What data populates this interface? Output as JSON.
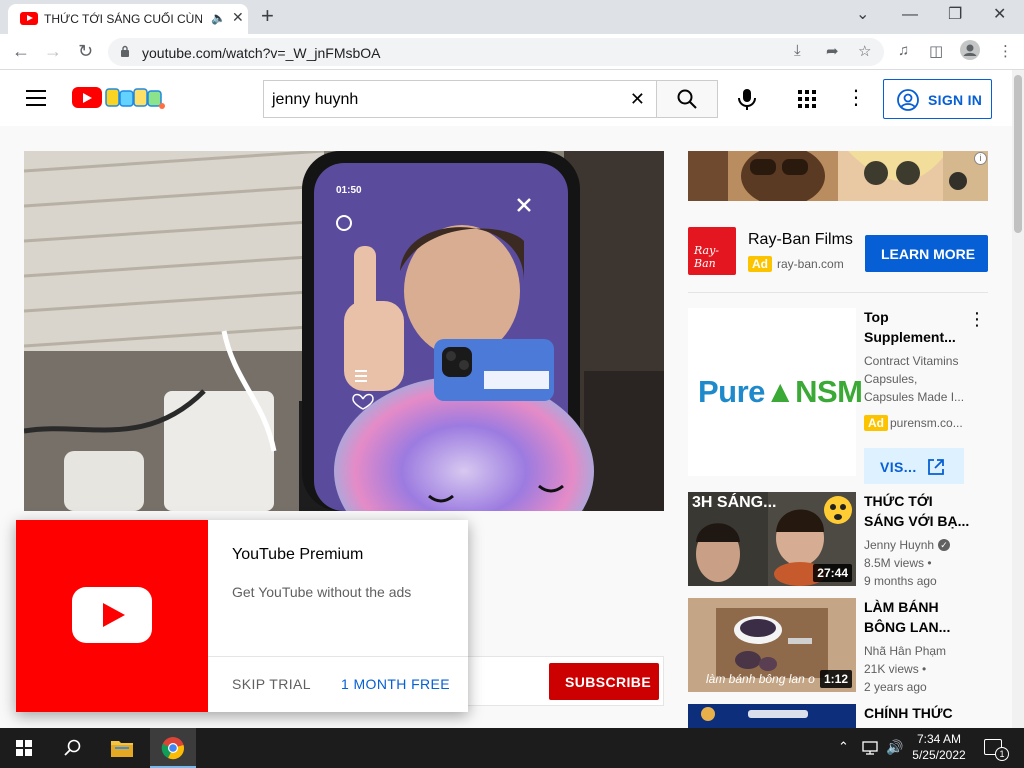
{
  "browser": {
    "tab_title": "THỨC TỚI SÁNG CUỐI CÙNG",
    "url": "youtube.com/watch?v=_W_jnFMsbOA"
  },
  "youtube": {
    "search_value": "jenny huynh",
    "sign_in_label": "SIGN IN"
  },
  "premium_popup": {
    "title": "YouTube Premium",
    "subtitle": "Get YouTube without the ads",
    "skip_label": "SKIP TRIAL",
    "free_label": "1 MONTH FREE"
  },
  "player": {
    "phone_time": "01:50",
    "subscribe_label": "SUBSCRIBE"
  },
  "ad_rayban": {
    "name": "Ray-Ban Films",
    "badge": "Ad",
    "domain": "ray-ban.com",
    "cta": "LEARN MORE",
    "logo_text": "Ray-Ban"
  },
  "ad_pure": {
    "title_line1": "Top",
    "title_line2": "Supplement...",
    "desc_line1": "Contract Vitamins",
    "desc_line2": "Capsules,",
    "desc_line3": "Capsules Made I...",
    "badge": "Ad",
    "domain": "purensm.co...",
    "cta": "VIS...",
    "logo_text_left": "Pure",
    "logo_text_right": "NSM"
  },
  "recommendations": [
    {
      "title_line1": "THỨC TỚI",
      "title_line2": "SÁNG VỚI BẠ...",
      "channel": "Jenny Huynh",
      "views": "8.5M views •",
      "age": "9 months ago",
      "duration": "27:44",
      "thumb_text": "3H SÁNG..."
    },
    {
      "title_line1": "LÀM BÁNH",
      "title_line2": "BÔNG LAN...",
      "channel": "Nhã Hân Phạm",
      "views": "21K views •",
      "age": "2 years ago",
      "duration": "1:12",
      "thumb_text": "làm bánh bông lan o"
    },
    {
      "title_line1": "CHÍNH THỨC"
    }
  ],
  "taskbar": {
    "time": "7:34 AM",
    "date": "5/25/2022",
    "notification_count": "1"
  },
  "colors": {
    "yt_red": "#ff0000",
    "yt_blue": "#065fd4",
    "subscribe_red": "#cc0000",
    "ad_yellow": "#fcc400"
  }
}
